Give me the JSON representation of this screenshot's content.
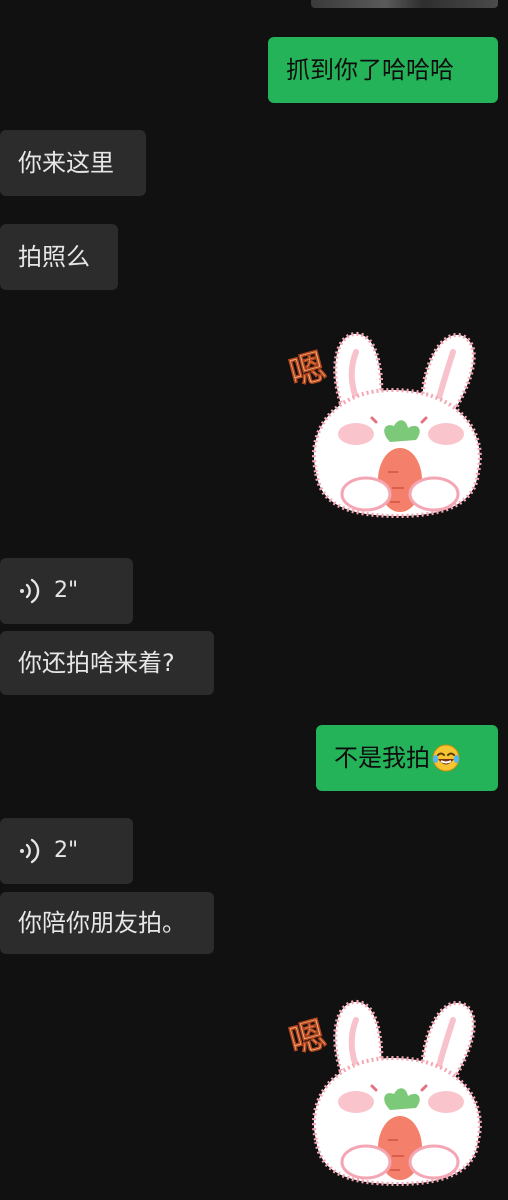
{
  "messages": {
    "m1": "抓到你了哈哈哈",
    "m2": "你来这里",
    "m3": "拍照么",
    "voice1": "2\"",
    "m4": "你还拍啥来着?",
    "m5": "不是我拍",
    "voice2": "2\"",
    "m6": "你陪你朋友拍。"
  },
  "sticker": {
    "icon": "bunny-carrot-sticker",
    "text": "嗯"
  },
  "colors": {
    "background": "#111111",
    "sent_bubble": "#25b35a",
    "received_bubble": "#2c2c2c"
  }
}
